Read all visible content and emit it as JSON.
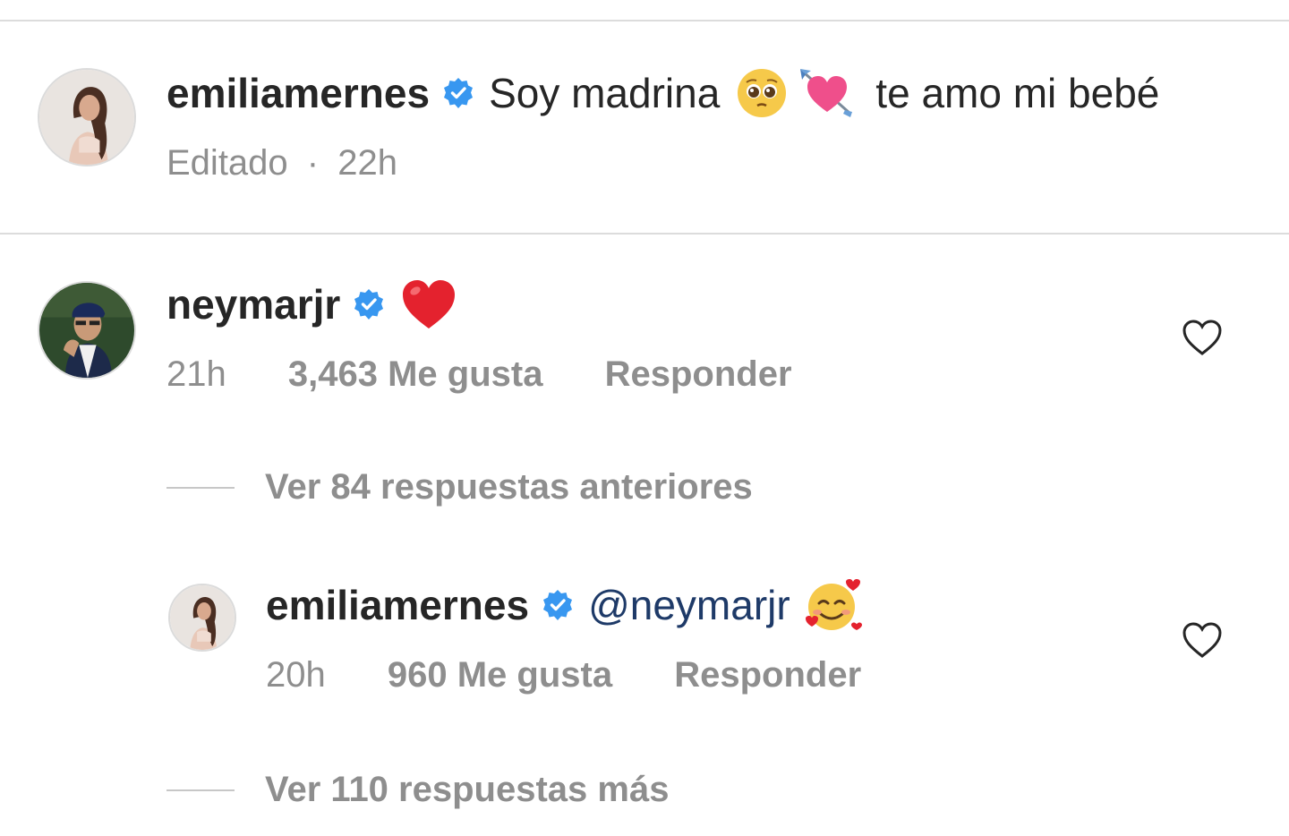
{
  "caption": {
    "username": "emiliamernes",
    "text_before": "Soy madrina",
    "text_after": "te amo mi bebé",
    "edited_label": "Editado",
    "separator": "·",
    "time": "22h"
  },
  "comment": {
    "username": "neymarjr",
    "time": "21h",
    "likes": "3,463 Me gusta",
    "reply_label": "Responder",
    "emoji": "red-heart-emoji"
  },
  "view_previous_replies": "Ver 84 respuestas anteriores",
  "reply": {
    "username": "emiliamernes",
    "mention": "@neymarjr",
    "time": "20h",
    "likes": "960 Me gusta",
    "reply_label": "Responder",
    "emoji": "smiling-face-with-hearts-emoji"
  },
  "view_more_replies": "Ver 110 respuestas más",
  "icons": {
    "verified": "verified-badge-icon",
    "like": "heart-outline-icon"
  },
  "colors": {
    "verified_blue": "#3897f0",
    "text_primary": "#262626",
    "text_secondary": "#8e8e8e",
    "mention": "#1e3a68"
  }
}
